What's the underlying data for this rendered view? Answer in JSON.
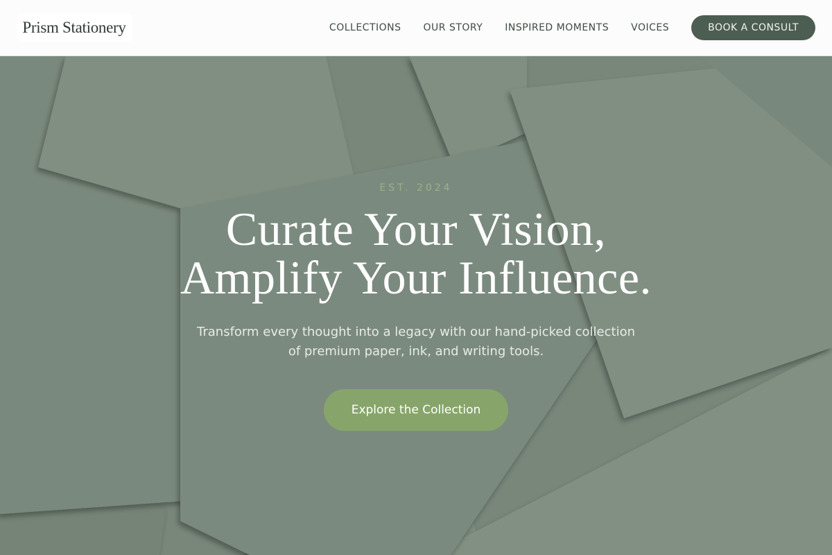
{
  "brand": {
    "name": "Prism Stationery"
  },
  "nav": {
    "links": [
      "COLLECTIONS",
      "OUR STORY",
      "INSPIRED MOMENTS",
      "VOICES"
    ],
    "cta_label": "BOOK A CONSULT"
  },
  "hero": {
    "eyebrow": "EST. 2024",
    "headline_line1": "Curate Your Vision,",
    "headline_line2": "Amplify Your Influence.",
    "subtext_line1": "Transform every thought into a legacy with our hand-picked collection",
    "subtext_line2": "of premium paper, ink, and writing tools.",
    "cta_label": "Explore the Collection",
    "background_image": "overlapping-sage-paper-sheets"
  },
  "colors": {
    "header_bg": "#fbfcfb",
    "nav_button_bg": "#4c5d51",
    "hero_overlay": "#7a8a7d",
    "cta_bg": "#87a56b",
    "eyebrow": "#a7bd8e"
  }
}
